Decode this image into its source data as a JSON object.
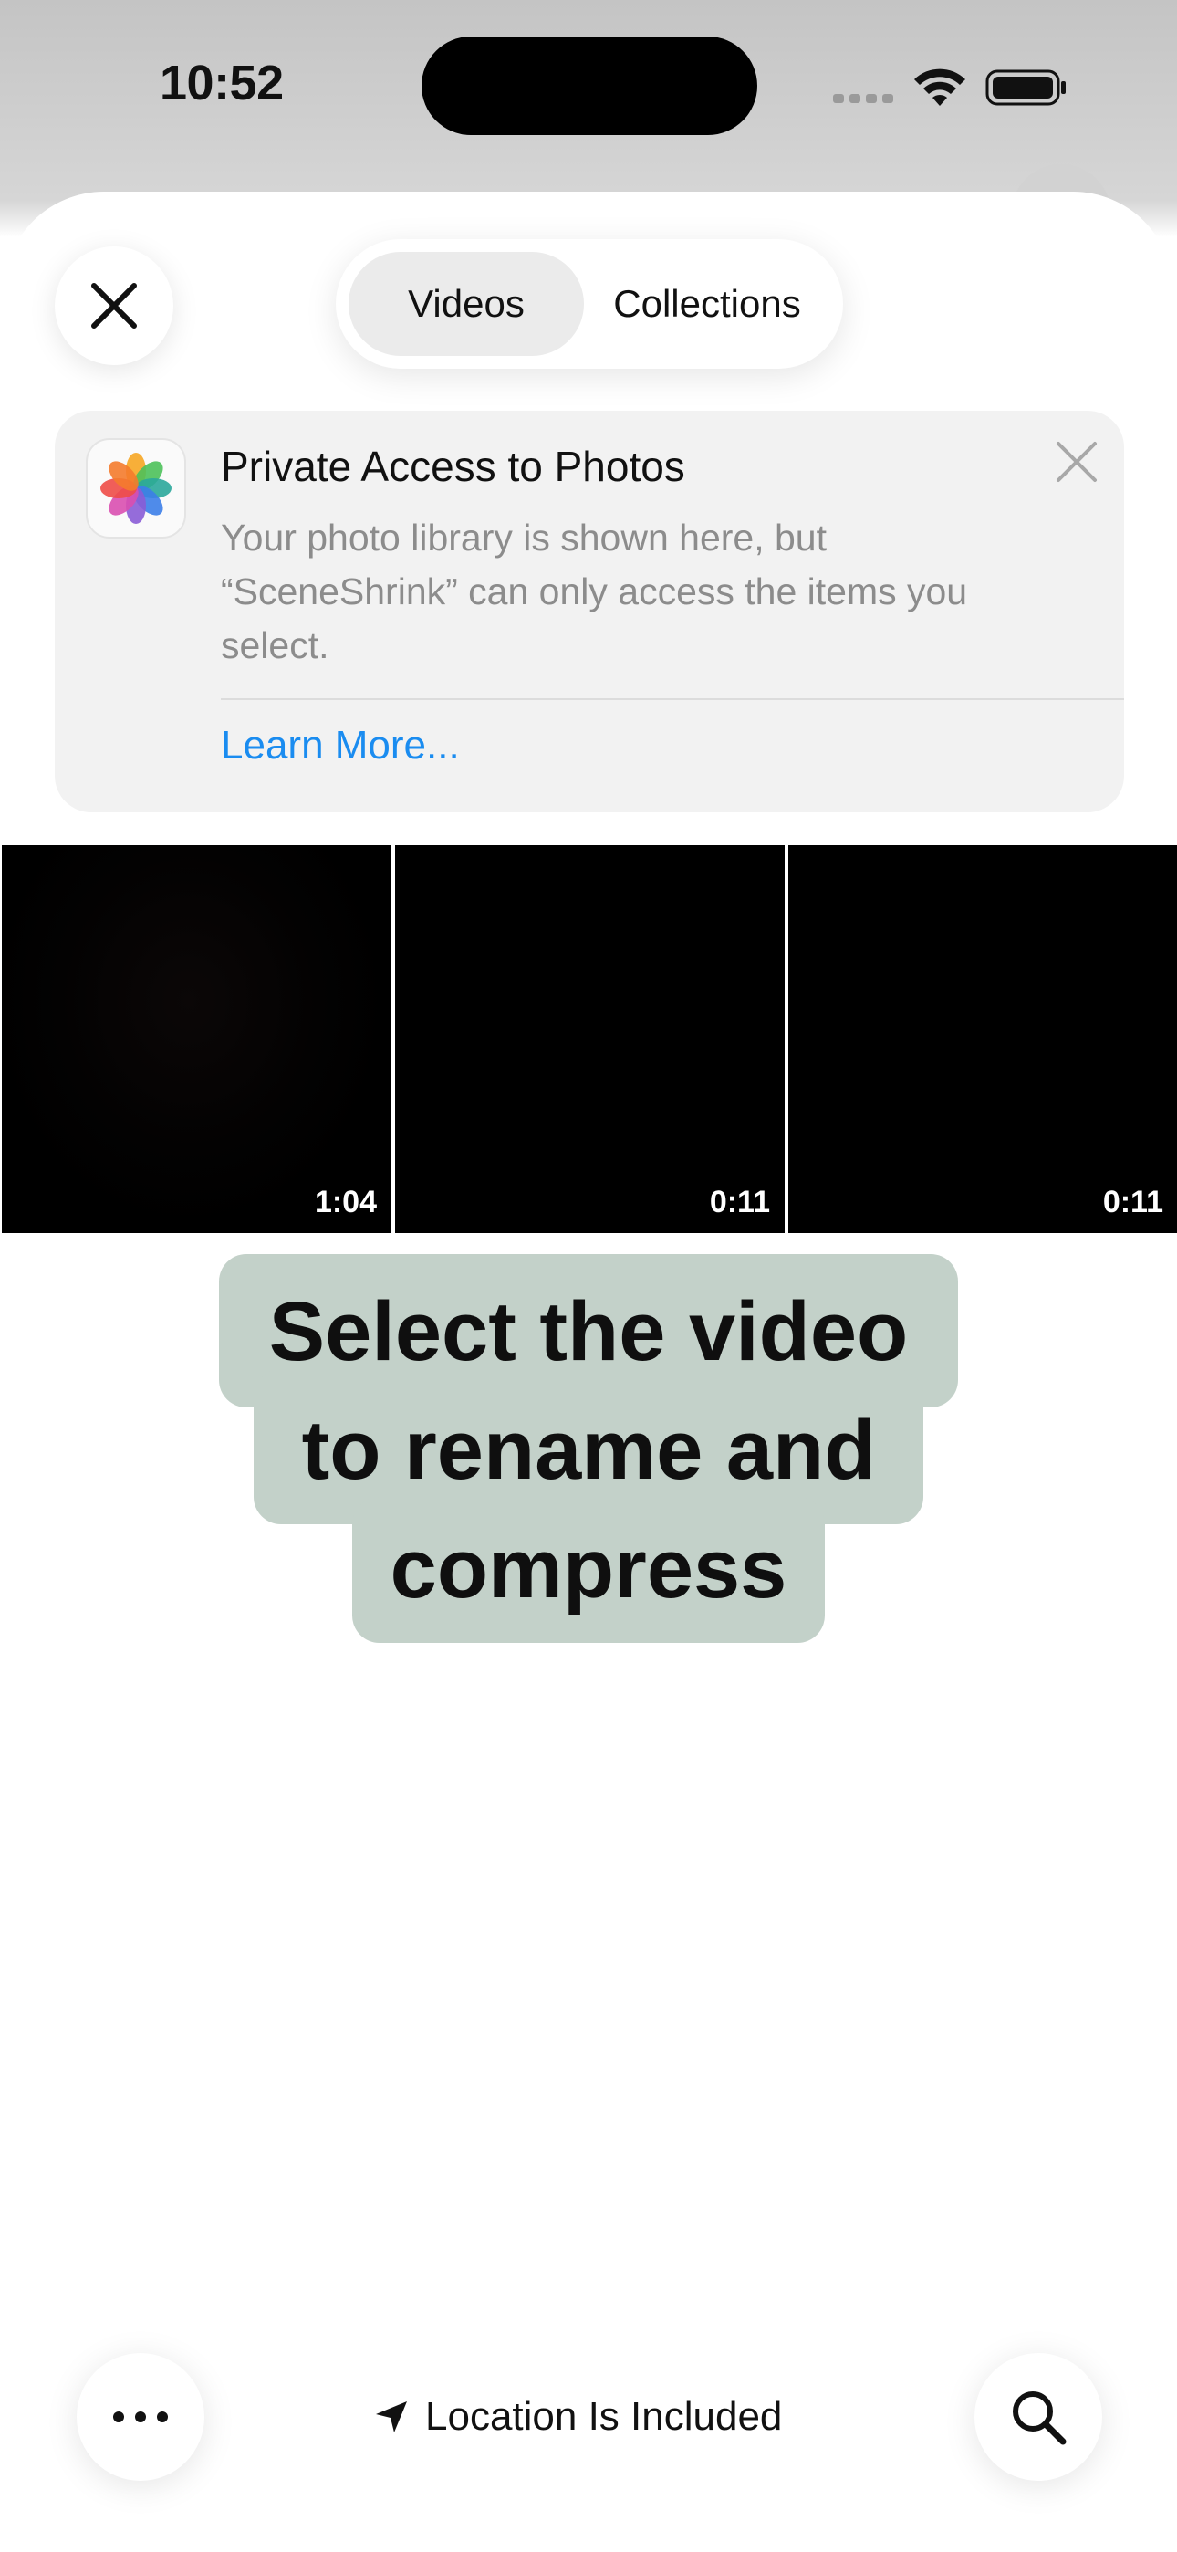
{
  "status_bar": {
    "time": "10:52"
  },
  "tabs": [
    {
      "label": "Videos",
      "active": true
    },
    {
      "label": "Collections",
      "active": false
    }
  ],
  "info_card": {
    "title": "Private Access to Photos",
    "body": "Your photo library is shown here, but “SceneShrink” can only access the items you select.",
    "link": "Learn More..."
  },
  "videos": [
    {
      "duration": "1:04"
    },
    {
      "duration": "0:11"
    },
    {
      "duration": "0:11"
    }
  ],
  "caption": {
    "line1": "Select the video",
    "line2": "to rename and",
    "line3": "compress"
  },
  "bottom_bar": {
    "location_label": "Location Is Included"
  },
  "colors": {
    "link": "#1a8cf0",
    "caption_bg": "#c3d1c9",
    "active_tab_bg": "#ebebeb"
  }
}
